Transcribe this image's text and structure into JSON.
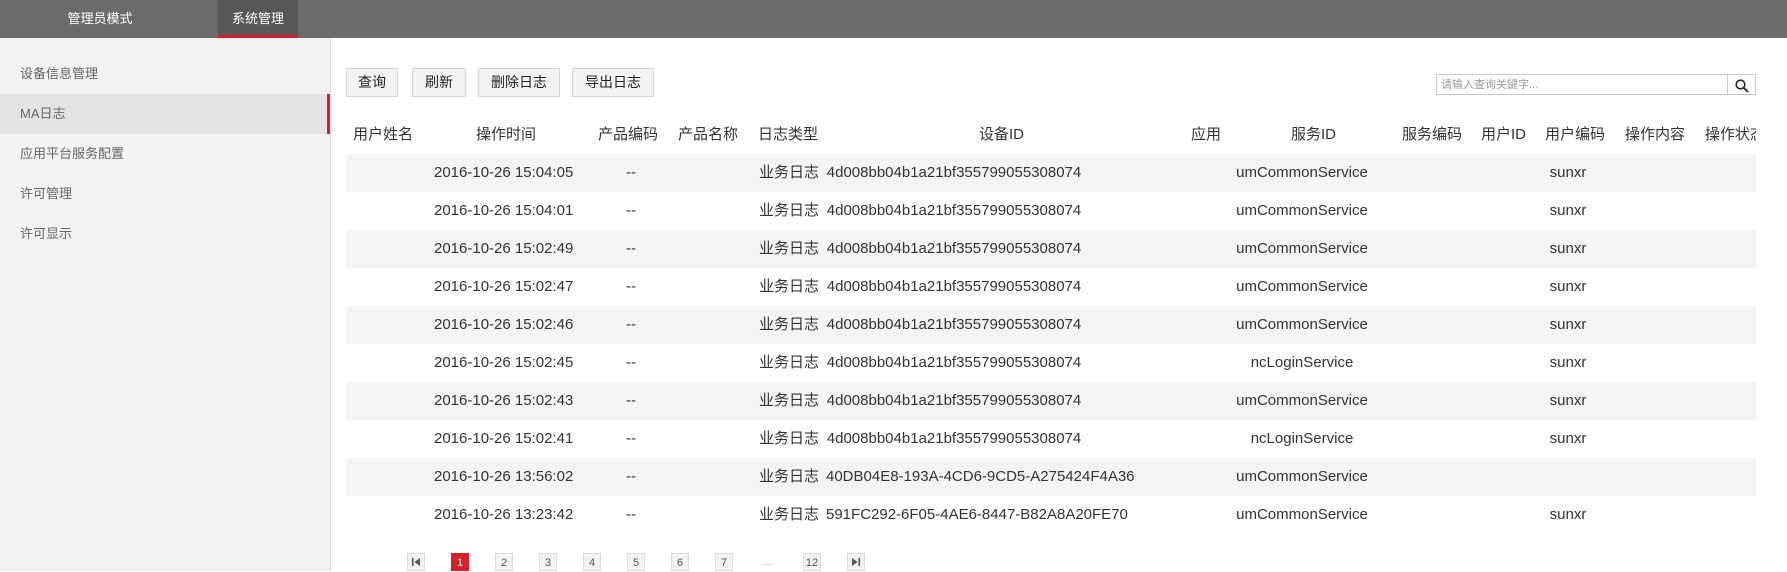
{
  "topbar": {
    "tabs": [
      {
        "label": "管理员模式"
      },
      {
        "label": "系统管理"
      }
    ]
  },
  "sidebar": {
    "items": [
      {
        "label": "设备信息管理"
      },
      {
        "label": "MA日志"
      },
      {
        "label": "应用平台服务配置"
      },
      {
        "label": "许可管理"
      },
      {
        "label": "许可显示"
      }
    ]
  },
  "toolbar": {
    "query_label": "查询",
    "refresh_label": "刷新",
    "delete_label": "删除日志",
    "export_label": "导出日志"
  },
  "search": {
    "placeholder": "请输入查询关键字...",
    "value": ""
  },
  "table": {
    "headers": [
      "用户姓名",
      "操作时间",
      "产品编码",
      "产品名称",
      "日志类型",
      "设备ID",
      "应用",
      "服务ID",
      "服务编码",
      "用户ID",
      "用户编码",
      "操作内容",
      "操作状态"
    ],
    "rows": [
      {
        "time": "2016-10-26 15:04:05",
        "product_code": "--",
        "log_type": "业务日志",
        "device_id": "4d008bb04b1a21bf355799055308074",
        "service_id": "umCommonService",
        "user_code": "sunxr"
      },
      {
        "time": "2016-10-26 15:04:01",
        "product_code": "--",
        "log_type": "业务日志",
        "device_id": "4d008bb04b1a21bf355799055308074",
        "service_id": "umCommonService",
        "user_code": "sunxr"
      },
      {
        "time": "2016-10-26 15:02:49",
        "product_code": "--",
        "log_type": "业务日志",
        "device_id": "4d008bb04b1a21bf355799055308074",
        "service_id": "umCommonService",
        "user_code": "sunxr"
      },
      {
        "time": "2016-10-26 15:02:47",
        "product_code": "--",
        "log_type": "业务日志",
        "device_id": "4d008bb04b1a21bf355799055308074",
        "service_id": "umCommonService",
        "user_code": "sunxr"
      },
      {
        "time": "2016-10-26 15:02:46",
        "product_code": "--",
        "log_type": "业务日志",
        "device_id": "4d008bb04b1a21bf355799055308074",
        "service_id": "umCommonService",
        "user_code": "sunxr"
      },
      {
        "time": "2016-10-26 15:02:45",
        "product_code": "--",
        "log_type": "业务日志",
        "device_id": "4d008bb04b1a21bf355799055308074",
        "service_id": "ncLoginService",
        "user_code": "sunxr"
      },
      {
        "time": "2016-10-26 15:02:43",
        "product_code": "--",
        "log_type": "业务日志",
        "device_id": "4d008bb04b1a21bf355799055308074",
        "service_id": "umCommonService",
        "user_code": "sunxr"
      },
      {
        "time": "2016-10-26 15:02:41",
        "product_code": "--",
        "log_type": "业务日志",
        "device_id": "4d008bb04b1a21bf355799055308074",
        "service_id": "ncLoginService",
        "user_code": "sunxr"
      },
      {
        "time": "2016-10-26 13:56:02",
        "product_code": "--",
        "log_type": "业务日志",
        "device_id": "40DB04E8-193A-4CD6-9CD5-A275424F4A36",
        "service_id": "umCommonService",
        "user_code": ""
      },
      {
        "time": "2016-10-26 13:23:42",
        "product_code": "--",
        "log_type": "业务日志",
        "device_id": "591FC292-6F05-4AE6-8447-B82A8A20FE70",
        "service_id": "umCommonService",
        "user_code": "sunxr"
      }
    ]
  },
  "pagination": {
    "pages": [
      "1",
      "2",
      "3",
      "4",
      "5",
      "6",
      "7",
      "...",
      "12"
    ],
    "current": "1",
    "first_icon": "first-page-icon",
    "last_icon": "last-page-icon"
  },
  "colors": {
    "accent": "#d8202a",
    "topbar": "#6b6b6d"
  }
}
